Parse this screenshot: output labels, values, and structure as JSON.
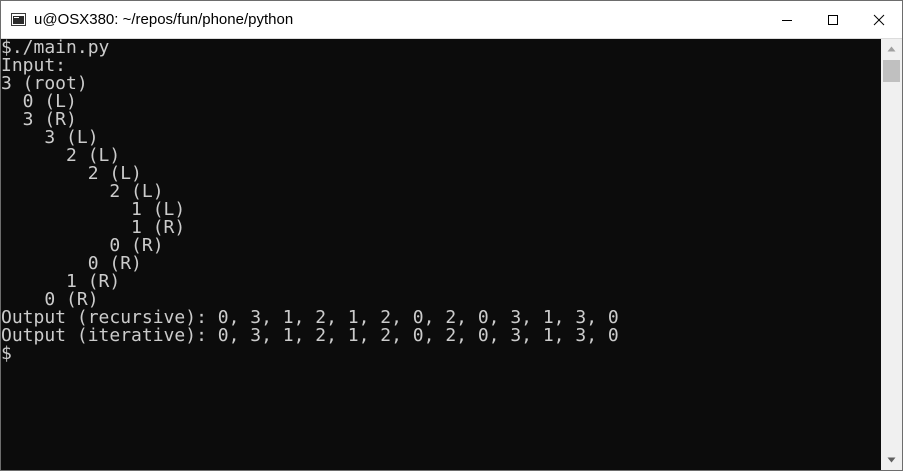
{
  "window": {
    "title": "u@OSX380: ~/repos/fun/phone/python"
  },
  "colors": {
    "terminal_bg": "#0c0c0c",
    "terminal_fg": "#cccccc",
    "titlebar_bg": "#ffffff"
  },
  "icons": {
    "app": "console-icon",
    "minimize": "minimize-icon",
    "maximize": "maximize-icon",
    "close": "close-icon",
    "scroll_up": "arrow-up-icon",
    "scroll_down": "arrow-down-icon"
  },
  "terminal": {
    "lines": [
      "$./main.py",
      "Input:",
      "3 (root)",
      "  0 (L)",
      "  3 (R)",
      "    3 (L)",
      "      2 (L)",
      "        2 (L)",
      "          2 (L)",
      "            1 (L)",
      "            1 (R)",
      "          0 (R)",
      "        0 (R)",
      "      1 (R)",
      "    0 (R)",
      "Output (recursive): 0, 3, 1, 2, 1, 2, 0, 2, 0, 3, 1, 3, 0",
      "Output (iterative): 0, 3, 1, 2, 1, 2, 0, 2, 0, 3, 1, 3, 0",
      "$"
    ]
  }
}
